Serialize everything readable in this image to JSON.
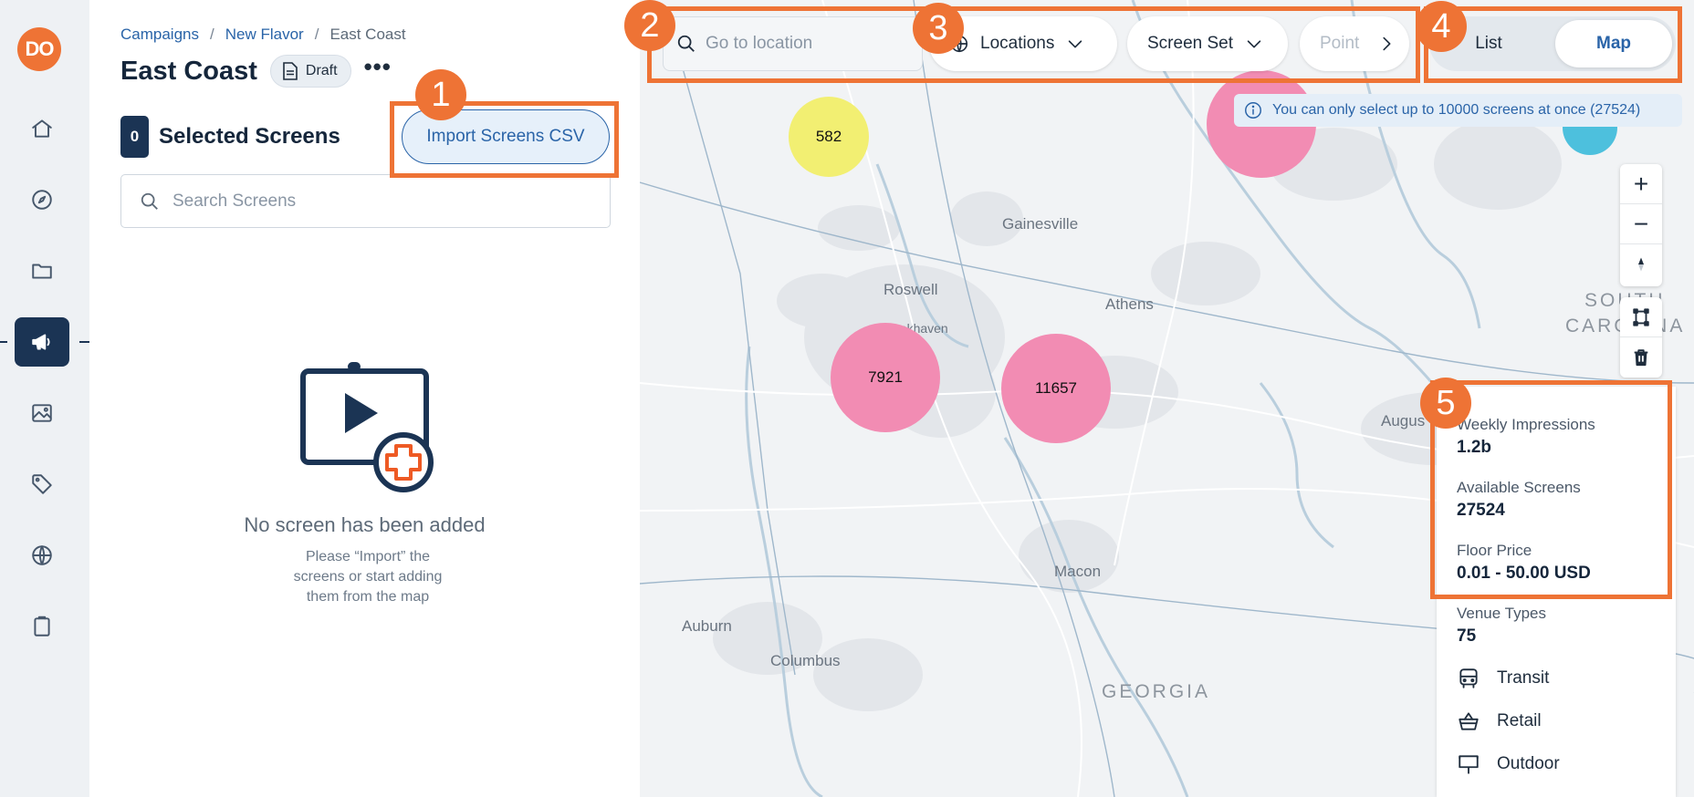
{
  "rail": {
    "avatar_initials": "DO",
    "items": [
      {
        "icon": "home-icon"
      },
      {
        "icon": "compass-icon"
      },
      {
        "icon": "folder-icon"
      },
      {
        "icon": "megaphone-icon",
        "active": true
      },
      {
        "icon": "image-icon"
      },
      {
        "icon": "tag-icon"
      },
      {
        "icon": "globe-icon"
      },
      {
        "icon": "clipboard-icon"
      }
    ]
  },
  "breadcrumb": {
    "items": [
      "Campaigns",
      "New Flavor",
      "East Coast"
    ],
    "separator": "/"
  },
  "header": {
    "title": "East Coast",
    "status": "Draft",
    "more": "•••"
  },
  "selection": {
    "count": "0",
    "label": "Selected Screens",
    "import_label": "Import Screens CSV"
  },
  "search": {
    "placeholder": "Search Screens"
  },
  "empty_state": {
    "title": "No screen has been added",
    "description": "Please “Import” the screens or start adding them from the map"
  },
  "map": {
    "search_placeholder": "Go to location",
    "filters": [
      "Locations",
      "Screen Set",
      "Point"
    ],
    "view_toggle": {
      "options": [
        "List",
        "Map"
      ],
      "selected": "Map"
    },
    "info_message": "You can only select up to 10000 screens at once (27524)",
    "clusters": [
      {
        "count": "582",
        "color": "#f2ef72"
      },
      {
        "count": "7921",
        "color": "#f28cb3"
      },
      {
        "count": "11657",
        "color": "#f28cb3"
      },
      {
        "count": "",
        "color": "#f28cb3"
      },
      {
        "count": "",
        "color": "#4dc0dd"
      }
    ],
    "labels": {
      "gainesville": "Gainesville",
      "roswell": "Roswell",
      "brookhaven": "Brookhaven",
      "athens": "Athens",
      "augusta": "Augus",
      "macon": "Macon",
      "auburn": "Auburn",
      "columbus": "Columbus",
      "georgia": "GEORGIA",
      "south": "SOUTH",
      "carolina": "CAROLINA"
    },
    "controls": {
      "zoom_in": "+",
      "zoom_out": "−"
    }
  },
  "stats": {
    "weekly_impressions_label": "Weekly Impressions",
    "weekly_impressions": "1.2b",
    "available_screens_label": "Available Screens",
    "available_screens": "27524",
    "floor_price_label": "Floor Price",
    "floor_price": "0.01 - 50.00 USD",
    "venue_types_label": "Venue Types",
    "venue_types": "75",
    "venues": [
      {
        "icon": "bus-icon",
        "label": "Transit"
      },
      {
        "icon": "basket-icon",
        "label": "Retail"
      },
      {
        "icon": "billboard-icon",
        "label": "Outdoor"
      }
    ]
  },
  "callouts": [
    "1",
    "2",
    "3",
    "4",
    "5"
  ],
  "colors": {
    "accent": "#ee7335",
    "navy": "#1b3454",
    "link": "#2a64a8"
  }
}
